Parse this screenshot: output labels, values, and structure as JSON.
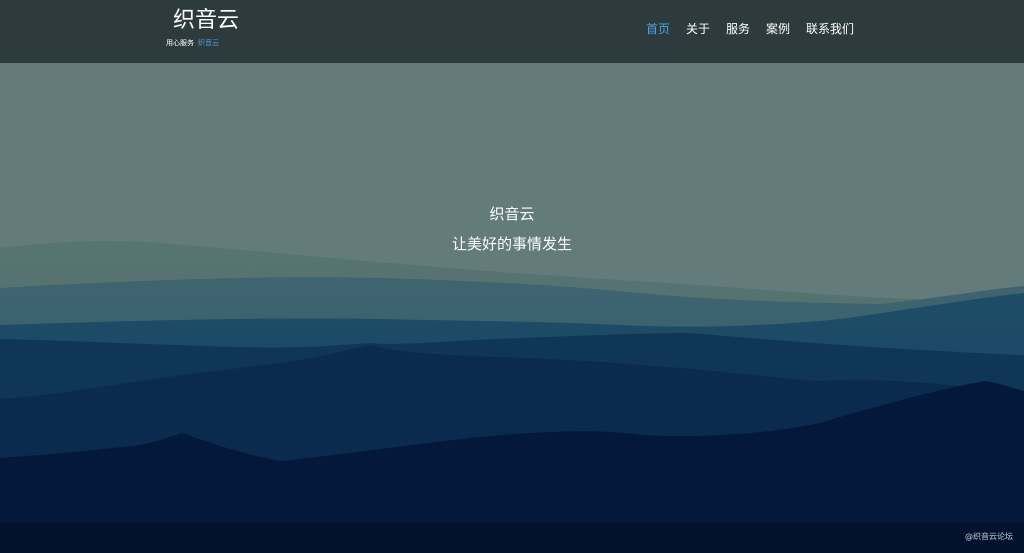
{
  "brand": {
    "name": "织音云",
    "tagline_prefix": "用心服务",
    "tagline_highlight": "织音云"
  },
  "nav": {
    "items": [
      {
        "label": "首页",
        "active": true
      },
      {
        "label": "关于",
        "active": false
      },
      {
        "label": "服务",
        "active": false
      },
      {
        "label": "案例",
        "active": false
      },
      {
        "label": "联系我们",
        "active": false
      }
    ]
  },
  "hero": {
    "title": "织音云",
    "slogan": "让美好的事情发生"
  },
  "watermark": "@织音云论坛",
  "colors": {
    "header_bg": "#2e3b3c",
    "sky": "#637b7a",
    "accent": "#4aa3e0",
    "deep": "#02091f"
  }
}
